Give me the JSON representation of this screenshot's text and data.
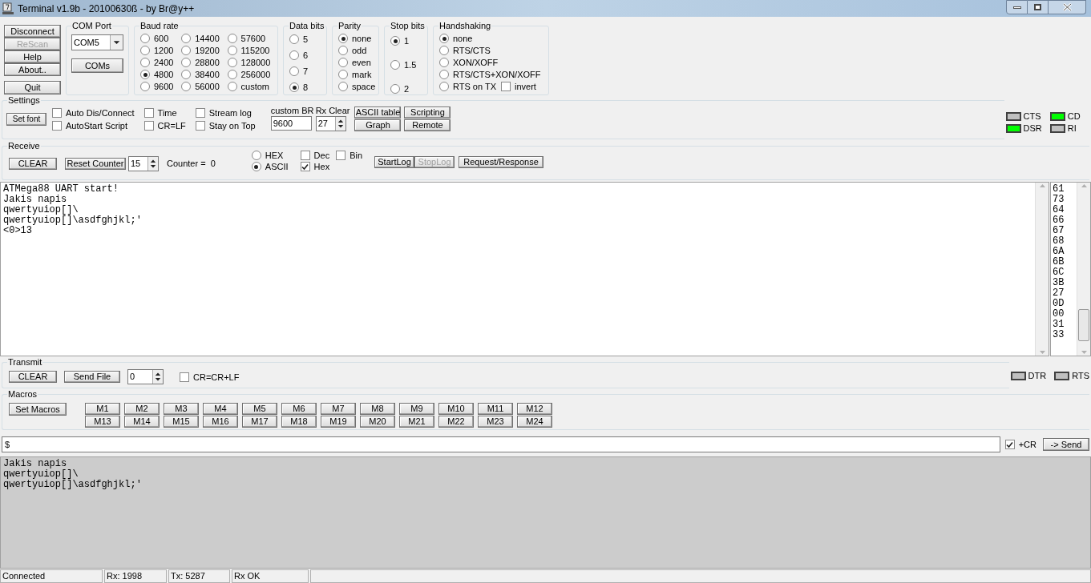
{
  "window": {
    "title": "Terminal v1.9b - 20100630ß - by Br@y++"
  },
  "side_buttons": [
    {
      "label": "Disconnect",
      "disabled": false
    },
    {
      "label": "ReScan",
      "disabled": true
    },
    {
      "label": "Help",
      "disabled": false
    },
    {
      "label": "About..",
      "disabled": false
    },
    {
      "label": "Quit",
      "disabled": false
    }
  ],
  "com_port": {
    "title": "COM Port",
    "value": "COM5",
    "button": "COMs"
  },
  "baud_rate": {
    "title": "Baud rate",
    "options": [
      {
        "label": "600",
        "selected": false
      },
      {
        "label": "1200",
        "selected": false
      },
      {
        "label": "2400",
        "selected": false
      },
      {
        "label": "4800",
        "selected": true
      },
      {
        "label": "9600",
        "selected": false
      },
      {
        "label": "14400",
        "selected": false
      },
      {
        "label": "19200",
        "selected": false
      },
      {
        "label": "28800",
        "selected": false
      },
      {
        "label": "38400",
        "selected": false
      },
      {
        "label": "56000",
        "selected": false
      },
      {
        "label": "57600",
        "selected": false
      },
      {
        "label": "115200",
        "selected": false
      },
      {
        "label": "128000",
        "selected": false
      },
      {
        "label": "256000",
        "selected": false
      },
      {
        "label": "custom",
        "selected": false
      }
    ]
  },
  "data_bits": {
    "title": "Data bits",
    "options": [
      {
        "label": "5",
        "selected": false
      },
      {
        "label": "6",
        "selected": false
      },
      {
        "label": "7",
        "selected": false
      },
      {
        "label": "8",
        "selected": true
      }
    ]
  },
  "parity": {
    "title": "Parity",
    "options": [
      {
        "label": "none",
        "selected": true
      },
      {
        "label": "odd",
        "selected": false
      },
      {
        "label": "even",
        "selected": false
      },
      {
        "label": "mark",
        "selected": false
      },
      {
        "label": "space",
        "selected": false
      }
    ]
  },
  "stop_bits": {
    "title": "Stop bits",
    "options": [
      {
        "label": "1",
        "selected": true
      },
      {
        "label": "1.5",
        "selected": false
      },
      {
        "label": "2",
        "selected": false
      }
    ]
  },
  "handshaking": {
    "title": "Handshaking",
    "options": [
      {
        "label": "none",
        "selected": true
      },
      {
        "label": "RTS/CTS",
        "selected": false
      },
      {
        "label": "XON/XOFF",
        "selected": false
      },
      {
        "label": "RTS/CTS+XON/XOFF",
        "selected": false
      },
      {
        "label": "RTS on TX",
        "selected": false
      }
    ],
    "invert": {
      "label": "invert",
      "checked": false
    }
  },
  "settings": {
    "title": "Settings",
    "set_font": "Set font",
    "checkboxes": [
      {
        "label": "Auto Dis/Connect",
        "checked": false
      },
      {
        "label": "AutoStart Script",
        "checked": false
      },
      {
        "label": "Time",
        "checked": false
      },
      {
        "label": "CR=LF",
        "checked": false
      },
      {
        "label": "Stream log",
        "checked": false
      },
      {
        "label": "Stay on Top",
        "checked": false
      }
    ],
    "custom_br": {
      "label": "custom BR",
      "value": "9600"
    },
    "rx_clear": {
      "label": "Rx Clear",
      "value": "27"
    },
    "buttons": [
      "ASCII table",
      "Scripting",
      "Graph",
      "Remote"
    ]
  },
  "line_indicators": [
    {
      "label": "CTS",
      "on": false
    },
    {
      "label": "CD",
      "on": true
    },
    {
      "label": "DSR",
      "on": true
    },
    {
      "label": "RI",
      "on": false
    }
  ],
  "receive": {
    "title": "Receive",
    "clear": "CLEAR",
    "reset_counter": "Reset Counter",
    "counter_spin": "15",
    "counter": "Counter =  0",
    "modes": [
      {
        "label": "HEX",
        "selected": false
      },
      {
        "label": "ASCII",
        "selected": true
      }
    ],
    "checkboxes": [
      {
        "label": "Dec",
        "checked": false
      },
      {
        "label": "Hex",
        "checked": true
      },
      {
        "label": "Bin",
        "checked": false
      }
    ],
    "log_buttons": [
      {
        "label": "StartLog",
        "disabled": false
      },
      {
        "label": "StopLog",
        "disabled": true
      }
    ],
    "request_response": "Request/Response",
    "text": [
      "ATMega88 UART start!",
      "Jakis napis",
      "qwertyuiop[]\\",
      "qwertyuiop[]\\asdfghjkl;'",
      "<0>13"
    ],
    "hex": [
      "61",
      "73",
      "64",
      "66",
      "67",
      "68",
      "6A",
      "6B",
      "6C",
      "3B",
      "27",
      "0D",
      "00",
      "31",
      "33"
    ]
  },
  "transmit": {
    "title": "Transmit",
    "clear": "CLEAR",
    "send_file": "Send File",
    "spin": "0",
    "cr_lf": {
      "label": "CR=CR+LF",
      "checked": false
    },
    "indicators": [
      {
        "label": "DTR",
        "on": false
      },
      {
        "label": "RTS",
        "on": false
      }
    ]
  },
  "macros": {
    "title": "Macros",
    "set_macros": "Set Macros",
    "buttons": [
      "M1",
      "M2",
      "M3",
      "M4",
      "M5",
      "M6",
      "M7",
      "M8",
      "M9",
      "M10",
      "M11",
      "M12",
      "M13",
      "M14",
      "M15",
      "M16",
      "M17",
      "M18",
      "M19",
      "M20",
      "M21",
      "M22",
      "M23",
      "M24"
    ]
  },
  "send_line": {
    "value": "$",
    "plus_cr": {
      "label": "+CR",
      "checked": true
    },
    "send": "-> Send"
  },
  "sent_text": [
    "Jakis napis",
    "qwertyuiop[]\\",
    "qwertyuiop[]\\asdfghjkl;'"
  ],
  "status_bar": [
    "Connected",
    "Rx: 1998",
    "Tx: 5287",
    "Rx OK"
  ]
}
